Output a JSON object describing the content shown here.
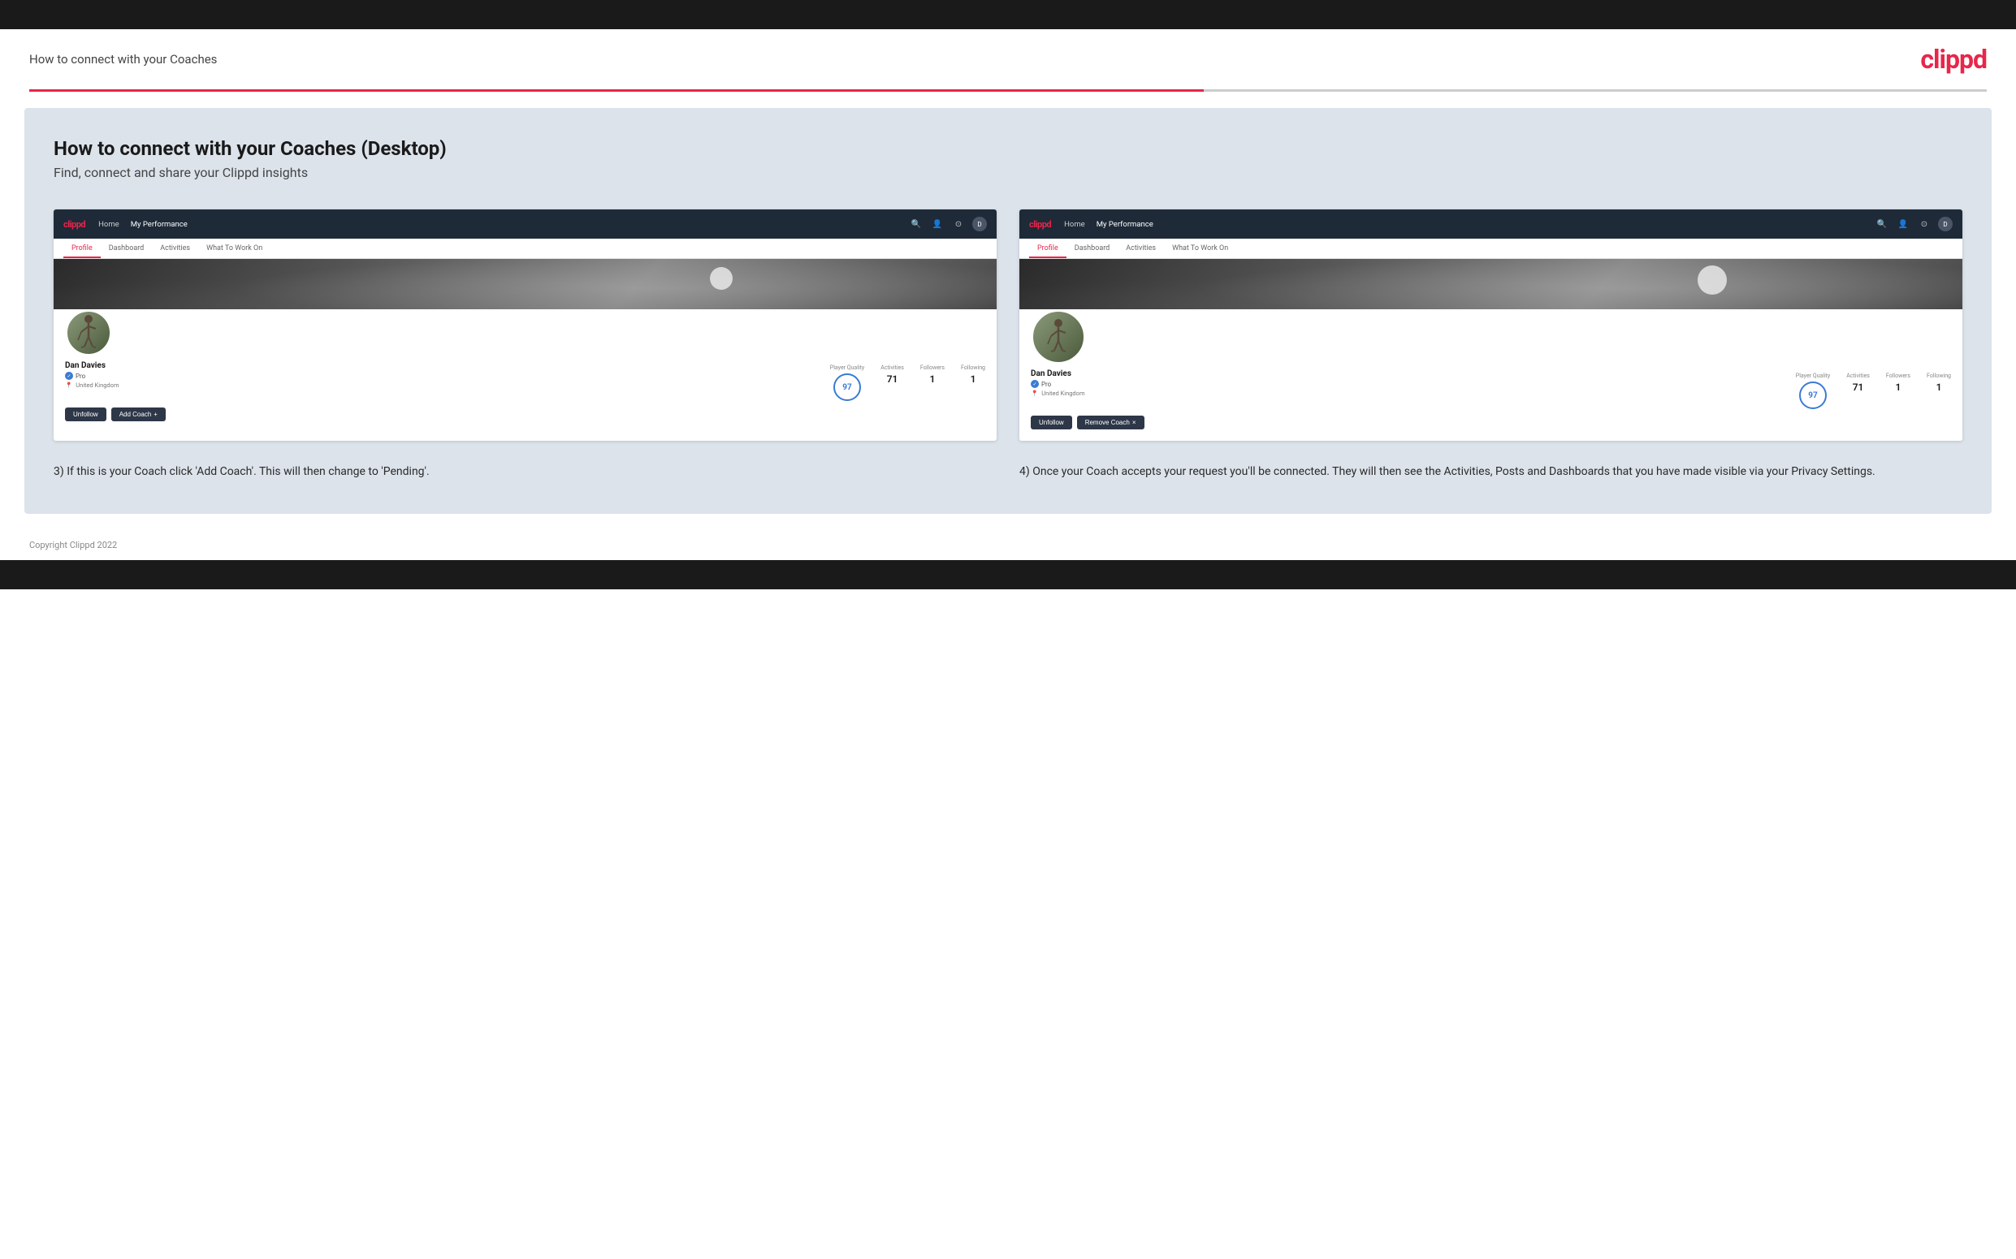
{
  "topBar": {},
  "header": {
    "title": "How to connect with your Coaches",
    "logo": "clippd"
  },
  "main": {
    "heading": "How to connect with your Coaches (Desktop)",
    "subheading": "Find, connect and share your Clippd insights",
    "panels": [
      {
        "id": "panel-left",
        "mockApp": {
          "nav": {
            "logo": "clippd",
            "items": [
              "Home",
              "My Performance"
            ]
          },
          "tabs": [
            "Profile",
            "Dashboard",
            "Activities",
            "What To Work On"
          ],
          "activeTab": "Profile",
          "playerName": "Dan Davies",
          "badge": "Pro",
          "location": "United Kingdom",
          "stats": {
            "playerQuality": {
              "label": "Player Quality",
              "value": "97"
            },
            "activities": {
              "label": "Activities",
              "value": "71"
            },
            "followers": {
              "label": "Followers",
              "value": "1"
            },
            "following": {
              "label": "Following",
              "value": "1"
            }
          },
          "buttons": [
            {
              "label": "Unfollow",
              "type": "dark"
            },
            {
              "label": "Add Coach",
              "type": "outline",
              "icon": "+"
            }
          ]
        },
        "description": "3) If this is your Coach click 'Add Coach'. This will then change to 'Pending'."
      },
      {
        "id": "panel-right",
        "mockApp": {
          "nav": {
            "logo": "clippd",
            "items": [
              "Home",
              "My Performance"
            ]
          },
          "tabs": [
            "Profile",
            "Dashboard",
            "Activities",
            "What To Work On"
          ],
          "activeTab": "Profile",
          "playerName": "Dan Davies",
          "badge": "Pro",
          "location": "United Kingdom",
          "stats": {
            "playerQuality": {
              "label": "Player Quality",
              "value": "97"
            },
            "activities": {
              "label": "Activities",
              "value": "71"
            },
            "followers": {
              "label": "Followers",
              "value": "1"
            },
            "following": {
              "label": "Following",
              "value": "1"
            }
          },
          "buttons": [
            {
              "label": "Unfollow",
              "type": "dark"
            },
            {
              "label": "Remove Coach",
              "type": "remove",
              "icon": "×"
            }
          ]
        },
        "description": "4) Once your Coach accepts your request you'll be connected. They will then see the Activities, Posts and Dashboards that you have made visible via your Privacy Settings."
      }
    ]
  },
  "footer": {
    "copyright": "Copyright Clippd 2022"
  }
}
